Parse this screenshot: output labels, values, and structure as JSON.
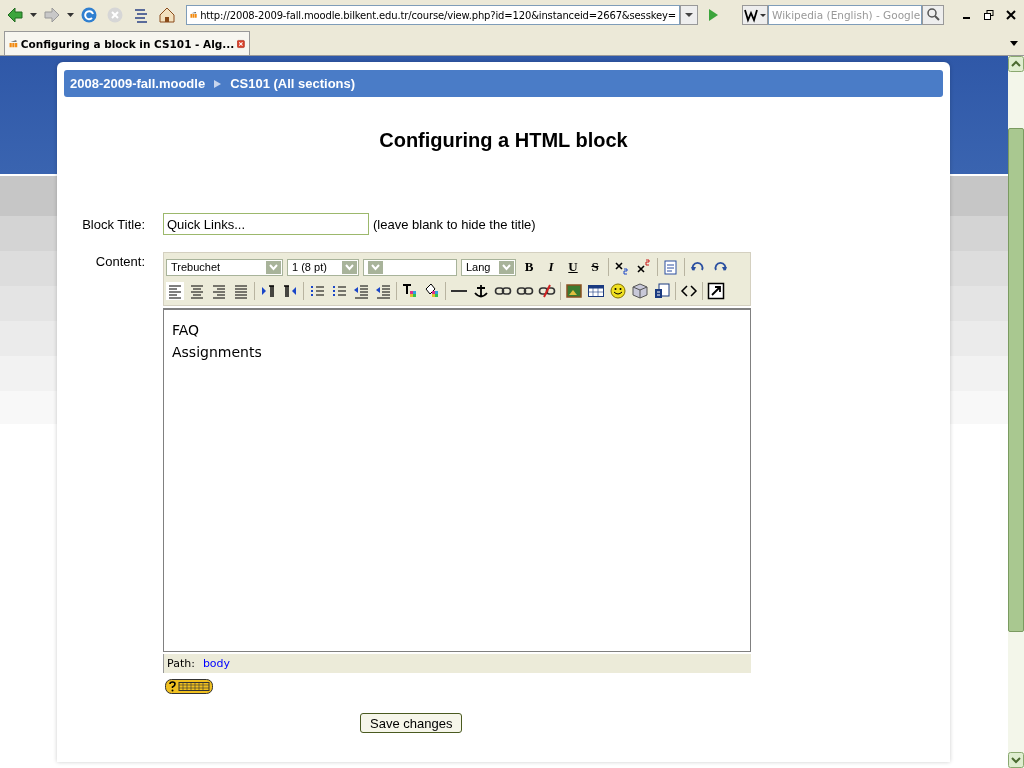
{
  "browser": {
    "url": "http://2008-2009-fall.moodle.bilkent.edu.tr/course/view.php?id=120&instanceid=2667&sesskey=",
    "search_placeholder": "Wikipedia (English) - Google",
    "tab_title": "Configuring a block in CS101 - Alg..."
  },
  "breadcrumb": [
    "2008-2009-fall.moodle",
    "CS101 (All sections)"
  ],
  "heading": "Configuring a HTML block",
  "block_title": {
    "label": "Block Title:",
    "value": "Quick Links...",
    "hint": "(leave blank to hide the title)"
  },
  "content": {
    "label": "Content:",
    "selects": [
      {
        "value": "Trebuchet"
      },
      {
        "value": "1 (8 pt)"
      },
      {
        "value": "Lang"
      }
    ],
    "format_buttons": [
      "B",
      "I",
      "U",
      "S"
    ],
    "lines": [
      "FAQ",
      "Assignments"
    ],
    "path_label": "Path:",
    "path_link": "body"
  },
  "save_button": "Save changes"
}
